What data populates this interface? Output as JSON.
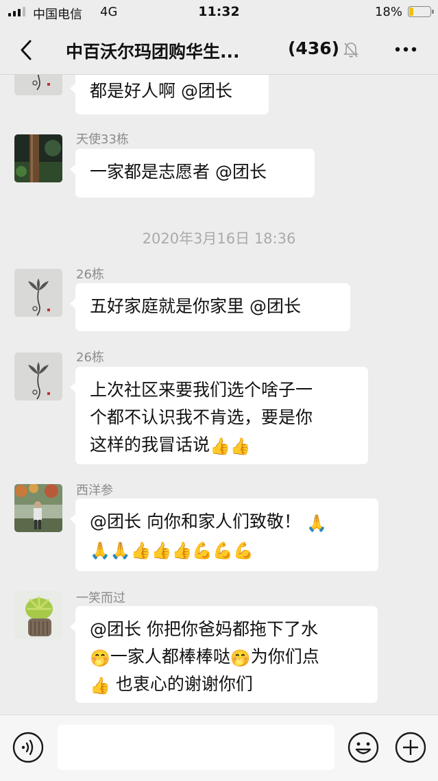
{
  "status_bar": {
    "carrier": "中国电信",
    "network": "4G",
    "time": "11:32",
    "battery": "18%",
    "battery_level": 0.18
  },
  "header": {
    "title": "中百沃尔玛团购华生...",
    "member_count": "(436)",
    "back_icon": "chevron-left-icon",
    "mute_icon": "bell-muted-icon",
    "more_icon": "ellipsis-icon"
  },
  "messages": [
    {
      "sender": "",
      "text": "都是好人啊 @团长",
      "avatar": "lotus-ink-avatar"
    },
    {
      "sender": "天使33栋",
      "text": "一家都是志愿者 @团长",
      "avatar": "tower-photo-avatar"
    },
    {
      "timestamp": "2020年3月16日 18:36"
    },
    {
      "sender": "26栋",
      "text": "五好家庭就是你家里 @团长",
      "avatar": "lotus-ink-avatar"
    },
    {
      "sender": "26栋",
      "lines": [
        "上次社区来要我们选个啥子一",
        "个都不认识我不肯选，要是你",
        "这样的我冒话说"
      ],
      "emoji_line3": "👍👍",
      "avatar": "lotus-ink-avatar"
    },
    {
      "sender": "西洋参",
      "line1": "@团长 向你和家人们致敬！",
      "emoji_line1": "🙏",
      "emoji_line2": "🙏🙏👍👍👍💪💪💪",
      "avatar": "garden-person-avatar"
    },
    {
      "sender": "一笑而过",
      "line1": "@团长 你把你爸妈都拖下了水",
      "line2a_emoji": "🤭",
      "line2b": "一家人都棒棒哒",
      "line2c_emoji": "🤭",
      "line2d": "为你们点",
      "line3_emoji": "👍",
      "line3": " 也衷心的谢谢你们",
      "avatar": "succulent-plant-avatar"
    }
  ],
  "input_bar": {
    "voice_icon": "voice-icon",
    "input_placeholder": "",
    "emoji_icon": "smiley-icon",
    "plus_icon": "plus-icon"
  },
  "colors": {
    "background": "#ededed",
    "bubble": "#ffffff",
    "battery": "#f2c100"
  }
}
